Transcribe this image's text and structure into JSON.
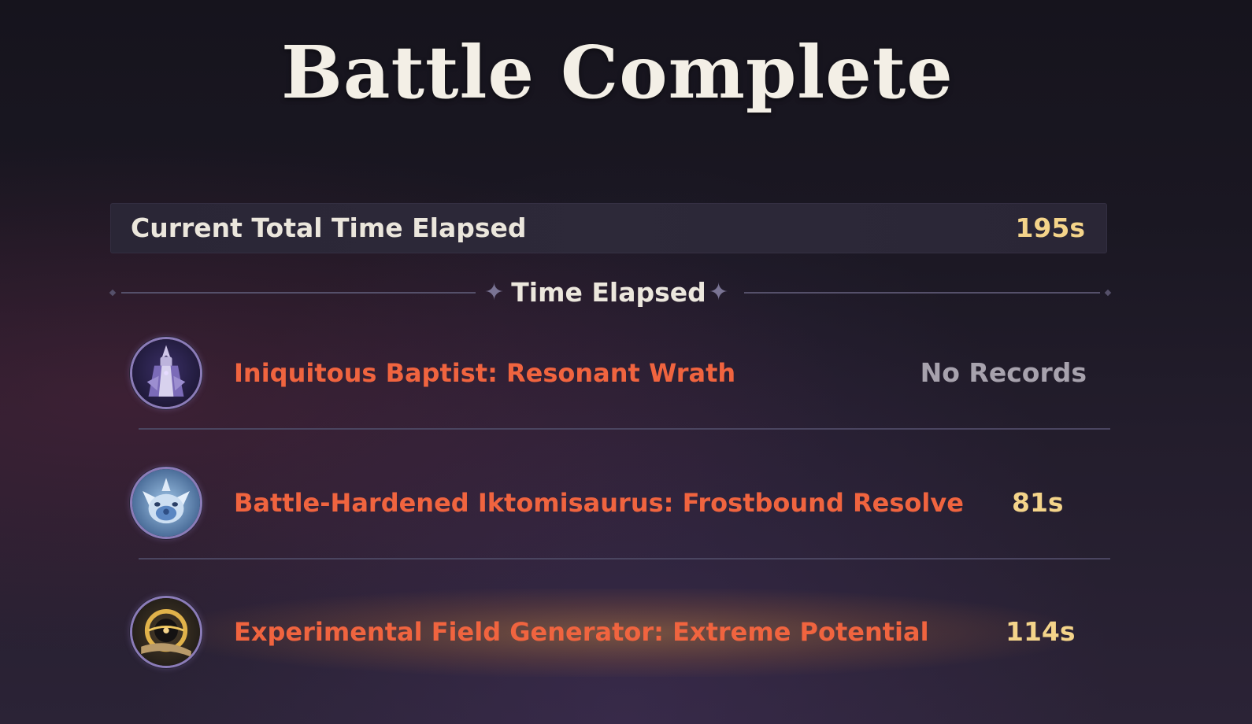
{
  "screen": {
    "title": "Battle Complete"
  },
  "total": {
    "label": "Current Total Time Elapsed",
    "value": "195s"
  },
  "section": {
    "label": "Time Elapsed"
  },
  "records": [
    {
      "icon": "iniquitous-baptist-icon",
      "name": "Iniquitous Baptist: Resonant Wrath",
      "time": "No Records"
    },
    {
      "icon": "iktomisaurus-icon",
      "name": "Battle-Hardened Iktomisaurus: Frostbound Resolve",
      "time": "81s"
    },
    {
      "icon": "field-generator-icon",
      "name": "Experimental Field Generator: Extreme Potential",
      "time": "114s"
    }
  ],
  "colors": {
    "boss_name": "#f0643f",
    "time_value": "#f4d48a",
    "no_record": "#a7a2ad",
    "highlight_glow": "#d48c3c"
  }
}
